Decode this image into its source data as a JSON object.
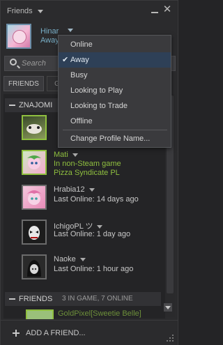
{
  "window": {
    "title": "Friends"
  },
  "profile": {
    "name": "Hinar",
    "status": "Away"
  },
  "search": {
    "placeholder": "Search"
  },
  "tabs": [
    {
      "label": "FRIENDS"
    },
    {
      "label": "G"
    }
  ],
  "groups": [
    {
      "name": "ZNAJOMI",
      "count": ""
    },
    {
      "name": "FRIENDS",
      "count": "3 IN GAME, 7 ONLINE"
    }
  ],
  "friends": [
    {
      "name": "",
      "line1": "",
      "line2": "",
      "ingame": true
    },
    {
      "name": "Mati",
      "line1": "In non-Steam game",
      "line2": "Pizza Syndicate PL",
      "ingame": true
    },
    {
      "name": "Hrabia12",
      "line1": "Last Online: 14 days ago",
      "line2": "",
      "ingame": false
    },
    {
      "name": "IchigoPL ツ",
      "line1": "Last Online: 1 day ago",
      "line2": "",
      "ingame": false
    },
    {
      "name": "Naoke",
      "line1": "Last Online: 1 hour ago",
      "line2": "",
      "ingame": false
    }
  ],
  "partial_friend": {
    "name": "GoldPixel[Sweetie Belle]"
  },
  "footer": {
    "add_friend": "ADD A FRIEND..."
  },
  "status_menu": {
    "items": [
      {
        "label": "Online",
        "selected": false
      },
      {
        "label": "Away",
        "selected": true
      },
      {
        "label": "Busy",
        "selected": false
      },
      {
        "label": "Looking to Play",
        "selected": false
      },
      {
        "label": "Looking to Trade",
        "selected": false
      },
      {
        "label": "Offline",
        "selected": false
      }
    ],
    "change_name": "Change Profile Name...",
    "check_glyph": "✔"
  },
  "colors": {
    "accent_blue": "#78aec6",
    "ingame_green": "#8fbf3f",
    "selected_bg": "#2e4057"
  }
}
